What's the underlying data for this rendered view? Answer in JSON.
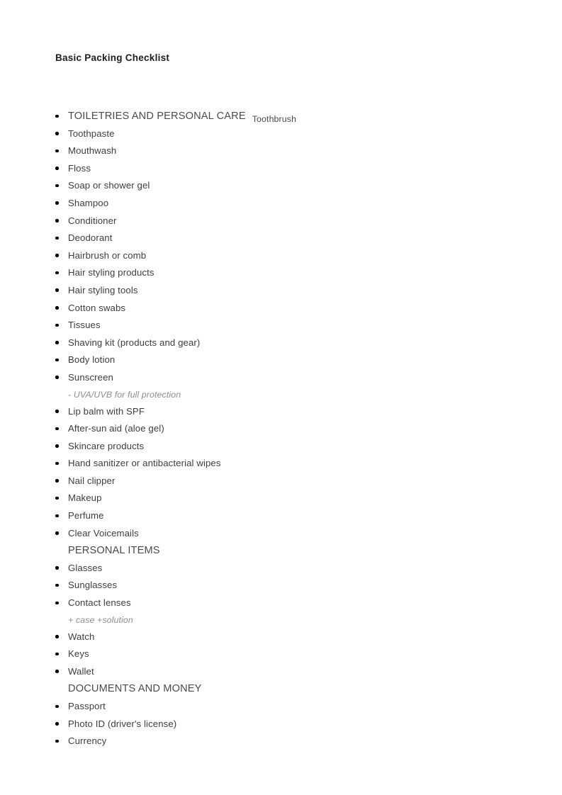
{
  "document": {
    "title": "Basic Packing Checklist"
  },
  "checklist": {
    "rows": [
      {
        "kind": "section-with-item",
        "bullet": true,
        "text": "TOILETRIES AND PERSONAL CARE",
        "trailing": "Toothbrush"
      },
      {
        "kind": "item",
        "bullet": true,
        "text": "Toothpaste"
      },
      {
        "kind": "item",
        "bullet": true,
        "text": "Mouthwash"
      },
      {
        "kind": "item",
        "bullet": true,
        "text": "Floss"
      },
      {
        "kind": "item",
        "bullet": true,
        "text": "Soap or shower gel"
      },
      {
        "kind": "item",
        "bullet": true,
        "text": "Shampoo"
      },
      {
        "kind": "item",
        "bullet": true,
        "text": "Conditioner"
      },
      {
        "kind": "item",
        "bullet": true,
        "text": "Deodorant"
      },
      {
        "kind": "item",
        "bullet": true,
        "text": "Hairbrush or comb"
      },
      {
        "kind": "item",
        "bullet": true,
        "text": "Hair styling products"
      },
      {
        "kind": "item",
        "bullet": true,
        "text": "Hair styling tools"
      },
      {
        "kind": "item",
        "bullet": true,
        "text": "Cotton swabs"
      },
      {
        "kind": "item",
        "bullet": true,
        "text": "Tissues"
      },
      {
        "kind": "item",
        "bullet": true,
        "text": "Shaving kit (products and gear)"
      },
      {
        "kind": "item",
        "bullet": true,
        "text": "Body lotion"
      },
      {
        "kind": "item",
        "bullet": true,
        "text": "Sunscreen"
      },
      {
        "kind": "subnote",
        "bullet": false,
        "text": "- UVA/UVB for full protection"
      },
      {
        "kind": "item",
        "bullet": true,
        "text": "Lip balm with SPF"
      },
      {
        "kind": "item",
        "bullet": true,
        "text": "After-sun aid (aloe gel)"
      },
      {
        "kind": "item",
        "bullet": true,
        "text": "Skincare products"
      },
      {
        "kind": "item",
        "bullet": true,
        "text": "Hand sanitizer or antibacterial wipes"
      },
      {
        "kind": "item",
        "bullet": true,
        "text": "Nail clipper"
      },
      {
        "kind": "item",
        "bullet": true,
        "text": "Makeup"
      },
      {
        "kind": "item",
        "bullet": true,
        "text": "Perfume"
      },
      {
        "kind": "item",
        "bullet": true,
        "text": "Clear Voicemails"
      },
      {
        "kind": "section",
        "bullet": false,
        "text": "PERSONAL ITEMS"
      },
      {
        "kind": "item",
        "bullet": true,
        "text": "Glasses"
      },
      {
        "kind": "item",
        "bullet": true,
        "text": "Sunglasses"
      },
      {
        "kind": "item",
        "bullet": true,
        "text": "Contact lenses"
      },
      {
        "kind": "subnote",
        "bullet": false,
        "text": "+ case +solution"
      },
      {
        "kind": "item",
        "bullet": true,
        "text": "Watch"
      },
      {
        "kind": "item",
        "bullet": true,
        "text": "Keys"
      },
      {
        "kind": "item",
        "bullet": true,
        "text": "Wallet"
      },
      {
        "kind": "section",
        "bullet": false,
        "text": "DOCUMENTS AND MONEY"
      },
      {
        "kind": "item",
        "bullet": true,
        "text": "Passport"
      },
      {
        "kind": "item",
        "bullet": true,
        "text": "Photo ID (driver's license)"
      },
      {
        "kind": "item",
        "bullet": true,
        "text": "Currency"
      }
    ]
  }
}
